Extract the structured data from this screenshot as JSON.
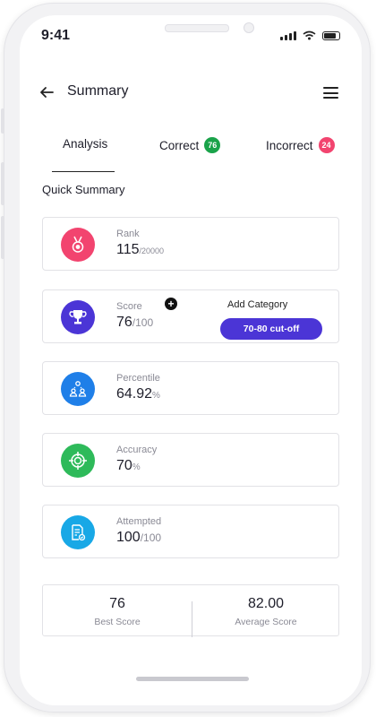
{
  "status_bar": {
    "time": "9:41"
  },
  "header": {
    "title": "Summary"
  },
  "tabs": [
    {
      "label": "Analysis"
    },
    {
      "label": "Correct",
      "count": "76"
    },
    {
      "label": "Incorrect",
      "count": "24"
    }
  ],
  "section_title": "Quick Summary",
  "cards": {
    "rank": {
      "label": "Rank",
      "value": "115",
      "unit": "/20000"
    },
    "score": {
      "label": "Score",
      "value": "76",
      "unit": "/100",
      "add_category_label": "Add Category",
      "cutoff_label": "70-80 cut-off"
    },
    "percentile": {
      "label": "Percentile",
      "value": "64.92",
      "unit": "%"
    },
    "accuracy": {
      "label": "Accuracy",
      "value": "70",
      "unit": "%"
    },
    "attempted": {
      "label": "Attempted",
      "value": "100",
      "unit": "/100"
    }
  },
  "summary": {
    "best": {
      "value": "76",
      "label": "Best Score"
    },
    "average": {
      "value": "82.00",
      "label": "Average Score"
    }
  },
  "colors": {
    "rank_icon": "#f2446f",
    "score_icon": "#4b35d6",
    "percentile_icon": "#1f7fe8",
    "accuracy_icon": "#2eba5a",
    "attempted_icon": "#18a8e6",
    "correct_badge": "#1aa34a",
    "incorrect_badge": "#f2446f",
    "accent": "#4b35d6"
  },
  "icons": {
    "rank": "medal-icon",
    "score": "trophy-icon",
    "percentile": "group-icon",
    "accuracy": "target-icon",
    "attempted": "document-icon"
  }
}
